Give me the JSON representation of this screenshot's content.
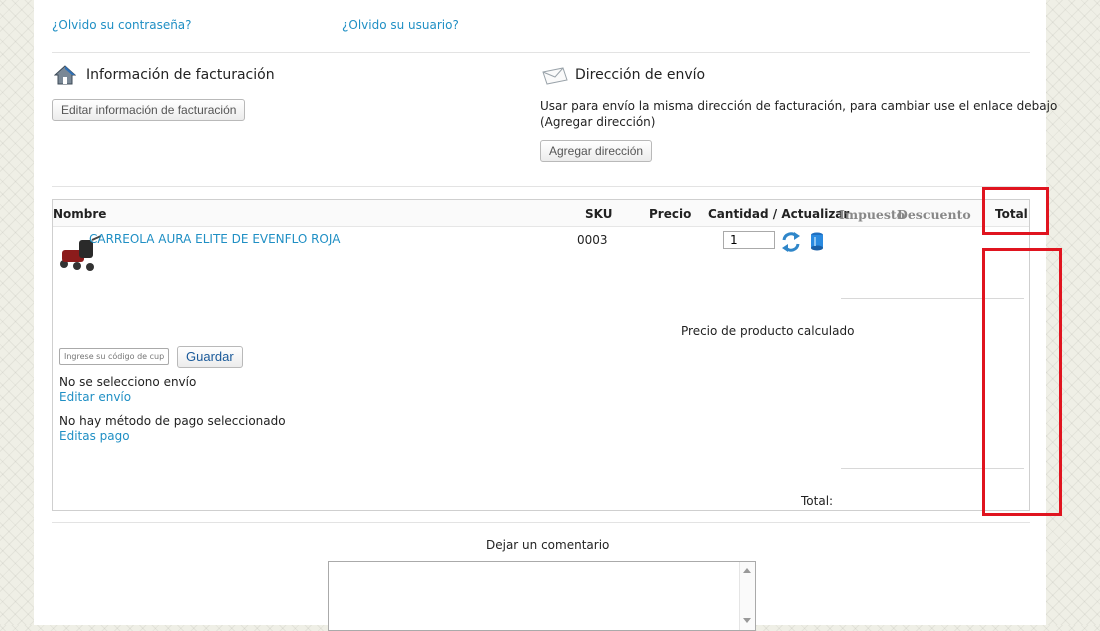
{
  "links": {
    "forgot_password": "¿Olvido su contraseña?",
    "forgot_user": "¿Olvido su usuario?"
  },
  "billing": {
    "title": "Información de facturación",
    "edit_button": "Editar información de facturación"
  },
  "shipping": {
    "title": "Dirección de envío",
    "note": "Usar para envío la misma dirección de facturación, para cambiar use el enlace debajo",
    "note2": "(Agregar dirección)",
    "add_button": "Agregar dirección"
  },
  "cart": {
    "columns": {
      "name": "Nombre",
      "sku": "SKU",
      "price": "Precio",
      "qty": "Cantidad / Actualizar",
      "tax": "Impuesto",
      "discount": "Descuento",
      "total": "Total"
    },
    "item": {
      "name": "CARREOLA AURA ELITE DE EVENFLO ROJA",
      "sku": "0003",
      "quantity": "1"
    },
    "product_price_label": "Precio de producto calculado",
    "total_label": "Total:"
  },
  "coupon": {
    "placeholder": "Ingrese su código de cupón",
    "save_button": "Guardar"
  },
  "shipment": {
    "status": "No se selecciono envío",
    "edit_link": "Editar envío"
  },
  "payment": {
    "status": "No hay método de pago seleccionado",
    "edit_link": "Editas pago"
  },
  "comment": {
    "label": "Dejar un comentario"
  },
  "icons": {
    "billing": "house-icon",
    "shipping": "envelope-icon",
    "refresh": "refresh-icon",
    "delete": "trash-icon"
  },
  "colors": {
    "link": "#1f8fc4",
    "highlight": "#e0141f"
  }
}
